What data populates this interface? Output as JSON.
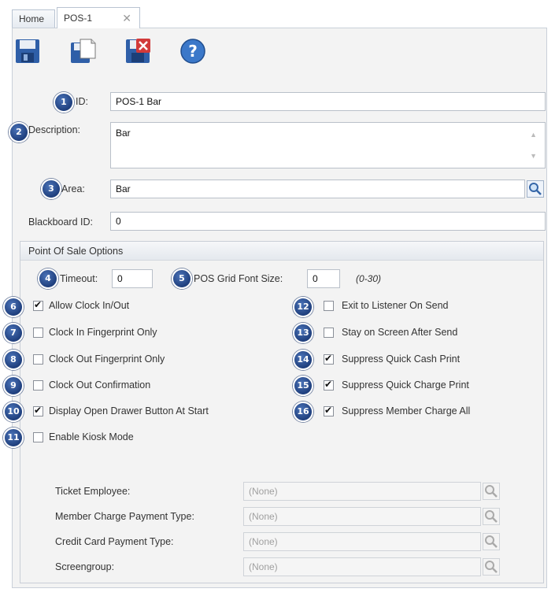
{
  "tabs": [
    {
      "label": "Home"
    },
    {
      "label": "POS-1",
      "close": "✕"
    }
  ],
  "toolbar": {
    "icons": [
      "save-icon",
      "save-new-icon",
      "delete-icon",
      "help-icon"
    ]
  },
  "fields": {
    "id": {
      "badge": "1",
      "label": "ID:",
      "value": "POS-1 Bar"
    },
    "description": {
      "badge": "2",
      "label": "Description:",
      "value": "Bar"
    },
    "area": {
      "badge": "3",
      "label": "Area:",
      "value": "Bar"
    },
    "blackboard": {
      "label": "Blackboard ID:",
      "value": "0"
    }
  },
  "group": {
    "title": "Point Of Sale Options",
    "timeout": {
      "badge": "4",
      "label": "Timeout:",
      "value": "0"
    },
    "grid_font": {
      "badge": "5",
      "label": "POS Grid Font Size:",
      "value": "0",
      "hint": "(0-30)"
    },
    "left_options": [
      {
        "badge": "6",
        "label": "Allow Clock In/Out",
        "checked": true
      },
      {
        "badge": "7",
        "label": "Clock In Fingerprint Only",
        "checked": false
      },
      {
        "badge": "8",
        "label": "Clock Out Fingerprint Only",
        "checked": false
      },
      {
        "badge": "9",
        "label": "Clock Out Confirmation",
        "checked": false
      },
      {
        "badge": "10",
        "label": "Display Open Drawer Button At Start",
        "checked": true
      },
      {
        "badge": "11",
        "label": "Enable Kiosk Mode",
        "checked": false
      }
    ],
    "right_options": [
      {
        "badge": "12",
        "label": "Exit to Listener On Send",
        "checked": false
      },
      {
        "badge": "13",
        "label": "Stay on Screen After Send",
        "checked": false
      },
      {
        "badge": "14",
        "label": "Suppress Quick Cash Print",
        "checked": true
      },
      {
        "badge": "15",
        "label": "Suppress Quick Charge Print",
        "checked": true
      },
      {
        "badge": "16",
        "label": "Suppress Member Charge All",
        "checked": true
      }
    ],
    "lookups": [
      {
        "label": "Ticket Employee:",
        "value": "(None)"
      },
      {
        "label": "Member Charge Payment Type:",
        "value": "(None)"
      },
      {
        "label": "Credit Card Payment Type:",
        "value": "(None)"
      },
      {
        "label": "Screengroup:",
        "value": "(None)"
      }
    ]
  }
}
